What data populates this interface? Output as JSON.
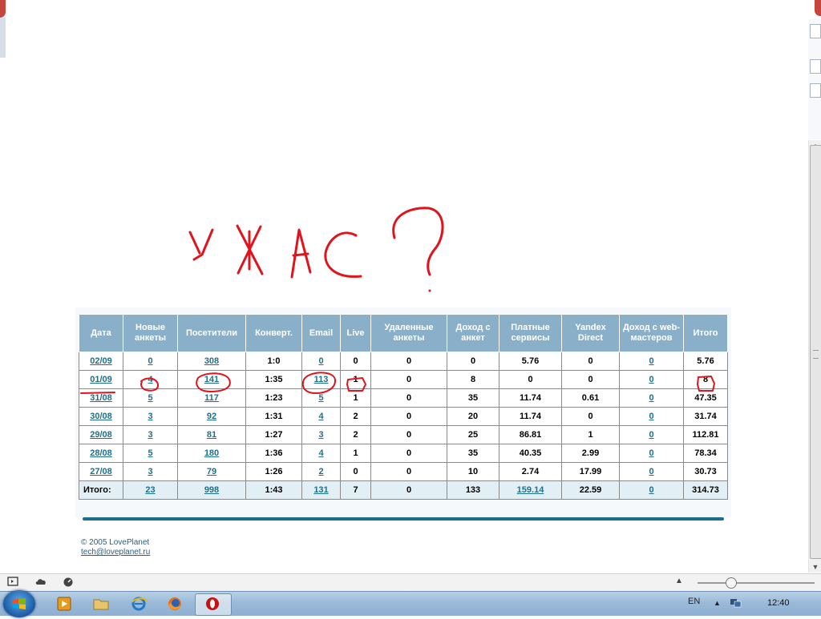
{
  "drawing_text": "УЖАС?",
  "table": {
    "headers": [
      "Дата",
      "Новые анкеты",
      "Посетители",
      "Конверт.",
      "Email",
      "Live",
      "Удаленные анкеты",
      "Доход с анкет",
      "Платные сервисы",
      "Yandex Direct",
      "Доход с web-мастеров",
      "Итого"
    ],
    "rows": [
      [
        "02/09",
        "0",
        "308",
        "1:0",
        "0",
        "0",
        "0",
        "0",
        "5.76",
        "0",
        "0",
        "5.76"
      ],
      [
        "01/09",
        "4",
        "141",
        "1:35",
        "113",
        "1",
        "0",
        "8",
        "0",
        "0",
        "0",
        "8"
      ],
      [
        "31/08",
        "5",
        "117",
        "1:23",
        "5",
        "1",
        "0",
        "35",
        "11.74",
        "0.61",
        "0",
        "47.35"
      ],
      [
        "30/08",
        "3",
        "92",
        "1:31",
        "4",
        "2",
        "0",
        "20",
        "11.74",
        "0",
        "0",
        "31.74"
      ],
      [
        "29/08",
        "3",
        "81",
        "1:27",
        "3",
        "2",
        "0",
        "25",
        "86.81",
        "1",
        "0",
        "112.81"
      ],
      [
        "28/08",
        "5",
        "180",
        "1:36",
        "4",
        "1",
        "0",
        "35",
        "40.35",
        "2.99",
        "0",
        "78.34"
      ],
      [
        "27/08",
        "3",
        "79",
        "1:26",
        "2",
        "0",
        "0",
        "10",
        "2.74",
        "17.99",
        "0",
        "30.73"
      ]
    ],
    "total": [
      "Итого:",
      "23",
      "998",
      "1:43",
      "131",
      "7",
      "0",
      "133",
      "159.14",
      "22.59",
      "0",
      "314.73"
    ],
    "link_columns": [
      0,
      1,
      2,
      4,
      10
    ],
    "total_link_columns": [
      1,
      2,
      4,
      8,
      10
    ]
  },
  "footer": {
    "copyright": "© 2005 LovePlanet",
    "email": "tech@loveplanet.ru"
  },
  "taskbar": {
    "language": "EN",
    "clock": "12:40"
  },
  "colors": {
    "header_bg": "#8aafc9",
    "link": "#1f6f8b",
    "annotation": "#e0141c"
  }
}
